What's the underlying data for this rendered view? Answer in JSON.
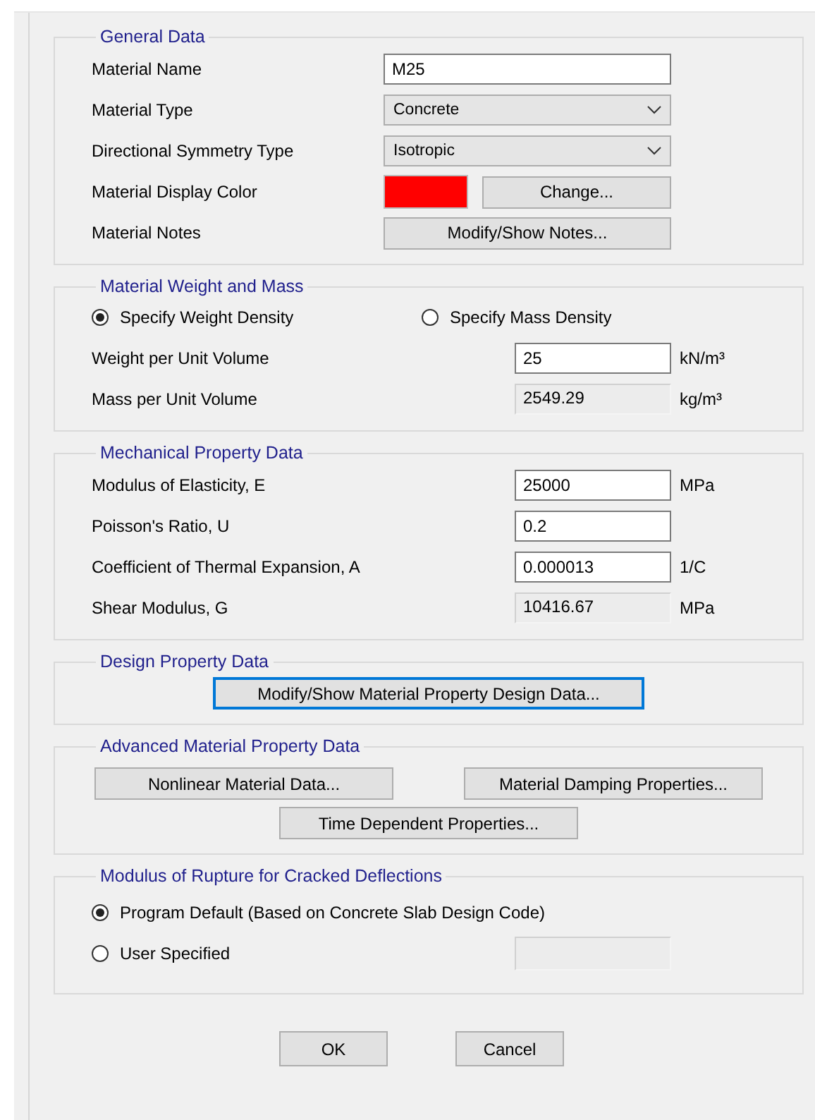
{
  "general": {
    "title": "General Data",
    "fields": [
      {
        "kind": "text",
        "label": "Material Name",
        "value": "M25"
      },
      {
        "kind": "dropdown",
        "label": "Material Type",
        "value": "Concrete"
      },
      {
        "kind": "dropdown",
        "label": "Directional Symmetry Type",
        "value": "Isotropic"
      },
      {
        "kind": "color",
        "label": "Material Display Color",
        "color": "#ff0000",
        "button": "Change..."
      },
      {
        "kind": "button",
        "label": "Material Notes",
        "button": "Modify/Show Notes..."
      }
    ]
  },
  "weight": {
    "title": "Material Weight and Mass",
    "options": [
      {
        "label": "Specify Weight Density",
        "selected": true
      },
      {
        "label": "Specify Mass Density",
        "selected": false
      }
    ],
    "rows": [
      {
        "label": "Weight per Unit Volume",
        "value": "25",
        "unit": "kN/m³",
        "disabled": false
      },
      {
        "label": "Mass per Unit Volume",
        "value": "2549.29",
        "unit": "kg/m³",
        "disabled": true
      }
    ]
  },
  "mechanical": {
    "title": "Mechanical Property Data",
    "rows": [
      {
        "label": "Modulus of Elasticity,  E",
        "value": "25000",
        "unit": "MPa",
        "disabled": false
      },
      {
        "label": "Poisson's Ratio,  U",
        "value": "0.2",
        "disabled": false
      },
      {
        "label": "Coefficient of Thermal Expansion,  A",
        "value": "0.000013",
        "unit": "1/C",
        "disabled": false
      },
      {
        "label": "Shear Modulus,  G",
        "value": "10416.67",
        "unit": "MPa",
        "disabled": true
      }
    ]
  },
  "design": {
    "title": "Design Property Data",
    "button": {
      "label": "Modify/Show Material Property Design Data...",
      "focused": true
    }
  },
  "advanced": {
    "title": "Advanced Material Property Data",
    "buttons": [
      "Nonlinear Material Data...",
      "Material Damping Properties...",
      "Time Dependent Properties..."
    ]
  },
  "rupture": {
    "title": "Modulus of Rupture for Cracked Deflections",
    "options": [
      {
        "label": "Program Default  (Based on Concrete Slab Design Code)",
        "selected": true
      },
      {
        "label": "User Specified",
        "selected": false,
        "field": {
          "disabled": true
        }
      }
    ]
  },
  "buttons": [
    "OK",
    "Cancel"
  ]
}
